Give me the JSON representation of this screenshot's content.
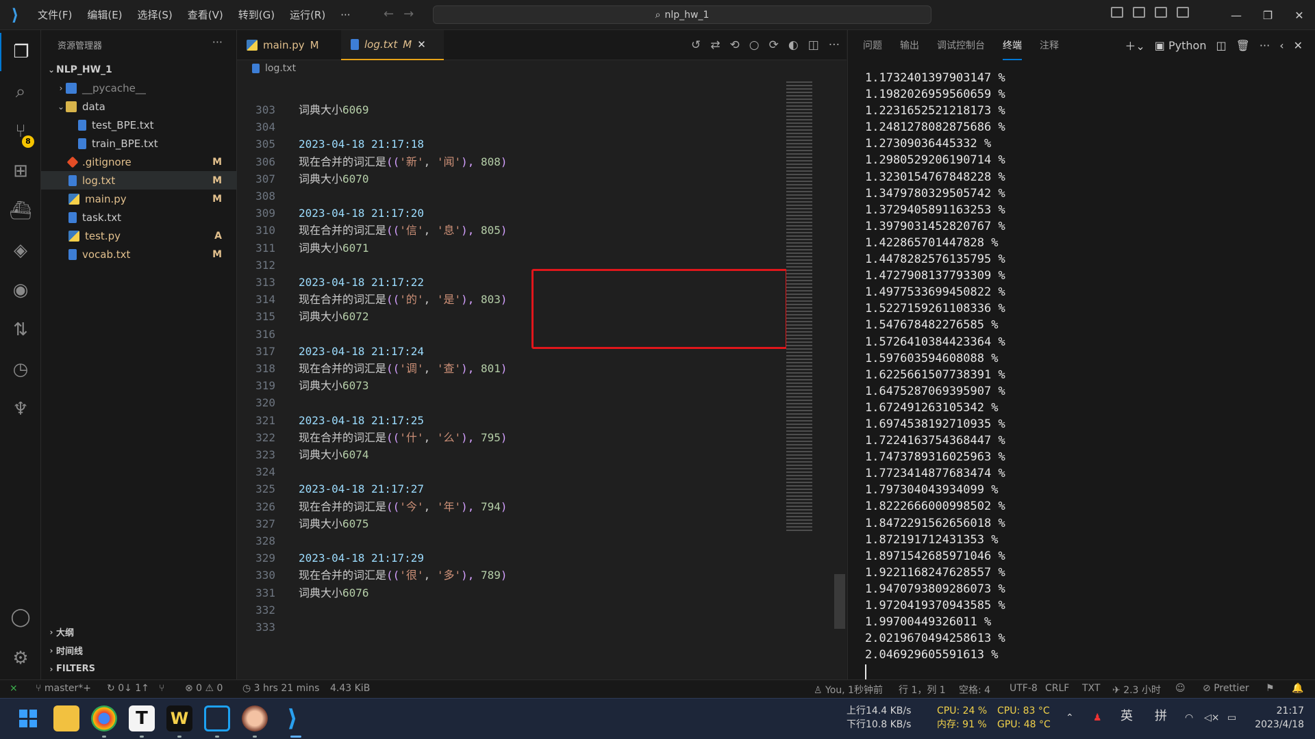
{
  "menu": [
    "文件(F)",
    "编辑(E)",
    "选择(S)",
    "查看(V)",
    "转到(G)",
    "运行(R)",
    "···"
  ],
  "search": {
    "text": "nlp_hw_1"
  },
  "sidebar": {
    "title": "资源管理器",
    "root": "NLP_HW_1",
    "items": [
      {
        "label": "__pycache__",
        "status": "",
        "color": "#8a8a8a"
      },
      {
        "label": "data",
        "status": "",
        "color": "#cccccc"
      },
      {
        "label": "test_BPE.txt",
        "status": "",
        "color": "#cccccc"
      },
      {
        "label": "train_BPE.txt",
        "status": "",
        "color": "#cccccc"
      },
      {
        "label": ".gitignore",
        "status": "M",
        "color": "#e2c08d"
      },
      {
        "label": "log.txt",
        "status": "M",
        "color": "#e2c08d"
      },
      {
        "label": "main.py",
        "status": "M",
        "color": "#e2c08d"
      },
      {
        "label": "task.txt",
        "status": "",
        "color": "#cccccc"
      },
      {
        "label": "test.py",
        "status": "A",
        "color": "#e2c08d"
      },
      {
        "label": "vocab.txt",
        "status": "M",
        "color": "#e2c08d"
      }
    ],
    "sections": [
      "大纲",
      "时间线",
      "FILTERS"
    ]
  },
  "source_control_badge": "8",
  "tabs": [
    {
      "label": "main.py",
      "status": "M"
    },
    {
      "label": "log.txt",
      "status": "M"
    }
  ],
  "breadcrumb": "log.txt",
  "code_lines": [
    {
      "n": "303",
      "parts": [
        [
          "词典大小",
          ""
        ],
        [
          "6069",
          "num"
        ]
      ]
    },
    {
      "n": "304",
      "parts": []
    },
    {
      "n": "305",
      "parts": [
        [
          "2023-04-18 21:17:18",
          "date"
        ]
      ]
    },
    {
      "n": "306",
      "parts": [
        [
          "现在合并的词汇是",
          ""
        ],
        [
          "((",
          "paren"
        ],
        [
          "'新'",
          "str"
        ],
        [
          ", ",
          ""
        ],
        [
          "'闻'",
          "str"
        ],
        [
          "), ",
          "paren"
        ],
        [
          "808",
          "num"
        ],
        [
          ")",
          "paren"
        ]
      ]
    },
    {
      "n": "307",
      "parts": [
        [
          "词典大小",
          ""
        ],
        [
          "6070",
          "num"
        ]
      ]
    },
    {
      "n": "308",
      "parts": []
    },
    {
      "n": "309",
      "parts": [
        [
          "2023-04-18 21:17:20",
          "date"
        ]
      ]
    },
    {
      "n": "310",
      "parts": [
        [
          "现在合并的词汇是",
          ""
        ],
        [
          "((",
          "paren"
        ],
        [
          "'信'",
          "str"
        ],
        [
          ", ",
          ""
        ],
        [
          "'息'",
          "str"
        ],
        [
          "), ",
          "paren"
        ],
        [
          "805",
          "num"
        ],
        [
          ")",
          "paren"
        ]
      ]
    },
    {
      "n": "311",
      "parts": [
        [
          "词典大小",
          ""
        ],
        [
          "6071",
          "num"
        ]
      ]
    },
    {
      "n": "312",
      "parts": []
    },
    {
      "n": "313",
      "parts": [
        [
          "2023-04-18 21:17:22",
          "date"
        ]
      ]
    },
    {
      "n": "314",
      "parts": [
        [
          "现在合并的词汇是",
          ""
        ],
        [
          "((",
          "paren"
        ],
        [
          "'的'",
          "str"
        ],
        [
          ", ",
          ""
        ],
        [
          "'是'",
          "str"
        ],
        [
          "), ",
          "paren"
        ],
        [
          "803",
          "num"
        ],
        [
          ")",
          "paren"
        ]
      ]
    },
    {
      "n": "315",
      "parts": [
        [
          "词典大小",
          ""
        ],
        [
          "6072",
          "num"
        ]
      ]
    },
    {
      "n": "316",
      "parts": []
    },
    {
      "n": "317",
      "parts": [
        [
          "2023-04-18 21:17:24",
          "date"
        ]
      ]
    },
    {
      "n": "318",
      "parts": [
        [
          "现在合并的词汇是",
          ""
        ],
        [
          "((",
          "paren"
        ],
        [
          "'调'",
          "str"
        ],
        [
          ", ",
          ""
        ],
        [
          "'查'",
          "str"
        ],
        [
          "), ",
          "paren"
        ],
        [
          "801",
          "num"
        ],
        [
          ")",
          "paren"
        ]
      ]
    },
    {
      "n": "319",
      "parts": [
        [
          "词典大小",
          ""
        ],
        [
          "6073",
          "num"
        ]
      ]
    },
    {
      "n": "320",
      "parts": []
    },
    {
      "n": "321",
      "parts": [
        [
          "2023-04-18 21:17:25",
          "date"
        ]
      ]
    },
    {
      "n": "322",
      "parts": [
        [
          "现在合并的词汇是",
          ""
        ],
        [
          "((",
          "paren"
        ],
        [
          "'什'",
          "str"
        ],
        [
          ", ",
          ""
        ],
        [
          "'么'",
          "str"
        ],
        [
          "), ",
          "paren"
        ],
        [
          "795",
          "num"
        ],
        [
          ")",
          "paren"
        ]
      ]
    },
    {
      "n": "323",
      "parts": [
        [
          "词典大小",
          ""
        ],
        [
          "6074",
          "num"
        ]
      ]
    },
    {
      "n": "324",
      "parts": []
    },
    {
      "n": "325",
      "parts": [
        [
          "2023-04-18 21:17:27",
          "date"
        ]
      ]
    },
    {
      "n": "326",
      "parts": [
        [
          "现在合并的词汇是",
          ""
        ],
        [
          "((",
          "paren"
        ],
        [
          "'今'",
          "str"
        ],
        [
          ", ",
          ""
        ],
        [
          "'年'",
          "str"
        ],
        [
          "), ",
          "paren"
        ],
        [
          "794",
          "num"
        ],
        [
          ")",
          "paren"
        ]
      ]
    },
    {
      "n": "327",
      "parts": [
        [
          "词典大小",
          ""
        ],
        [
          "6075",
          "num"
        ]
      ]
    },
    {
      "n": "328",
      "parts": []
    },
    {
      "n": "329",
      "parts": [
        [
          "2023-04-18 21:17:29",
          "date"
        ]
      ]
    },
    {
      "n": "330",
      "parts": [
        [
          "现在合并的词汇是",
          ""
        ],
        [
          "((",
          "paren"
        ],
        [
          "'很'",
          "str"
        ],
        [
          ", ",
          ""
        ],
        [
          "'多'",
          "str"
        ],
        [
          "), ",
          "paren"
        ],
        [
          "789",
          "num"
        ],
        [
          ")",
          "paren"
        ]
      ]
    },
    {
      "n": "331",
      "parts": [
        [
          "词典大小",
          ""
        ],
        [
          "6076",
          "num"
        ]
      ]
    },
    {
      "n": "332",
      "parts": []
    },
    {
      "n": "333",
      "parts": []
    }
  ],
  "panel": {
    "tabs": [
      "问题",
      "输出",
      "调试控制台",
      "终端",
      "注释"
    ],
    "active_tab": "终端",
    "shell": "Python",
    "terminal_lines": [
      "1.1732401397903147 %",
      "1.1982026959560659 %",
      "1.2231652521218173 %",
      "1.2481278082875686 %",
      "1.27309036445332 %",
      "1.2980529206190714 %",
      "1.3230154767848228 %",
      "1.3479780329505742 %",
      "1.3729405891163253 %",
      "1.3979031452820767 %",
      "1.422865701447828 %",
      "1.4478282576135795 %",
      "1.4727908137793309 %",
      "1.4977533699450822 %",
      "1.5227159261108336 %",
      "1.547678482276585 %",
      "1.5726410384423364 %",
      "1.597603594608088 %",
      "1.6225661507738391 %",
      "1.6475287069395907 %",
      "1.672491263105342 %",
      "1.6974538192710935 %",
      "1.7224163754368447 %",
      "1.7473789316025963 %",
      "1.7723414877683474 %",
      "1.797304043934099 %",
      "1.8222666000998502 %",
      "1.8472291562656018 %",
      "1.872191712431353 %",
      "1.8971542685971046 %",
      "1.9221168247628557 %",
      "1.9470793809286073 %",
      "1.9720419370943585 %",
      "1.99700449326011 %",
      "2.0219670494258613 %",
      "2.046929605591613 %"
    ]
  },
  "status": {
    "branch": "master*+",
    "sync": "0↓ 1↑",
    "problems": "⊗ 0 ⚠ 0",
    "time": "3 hrs 21 mins",
    "size": "4.43 KiB",
    "blame": "You, 1秒钟前",
    "position": "行 1，列 1",
    "spaces": "空格: 4",
    "encoding": "UTF-8",
    "eol": "CRLF",
    "lang": "TXT",
    "elapsed": "2.3 小时",
    "prettier": "Prettier"
  },
  "taskbar": {
    "net_up": "上行14.4 KB/s",
    "net_down": "下行10.8 KB/s",
    "cpu": "CPU: 24 %",
    "mem": "内存: 91 %",
    "cpu_temp": "CPU: 83 °C",
    "gpu_temp": "GPU: 48 °C",
    "ime1": "英",
    "ime2": "拼",
    "clock_time": "21:17",
    "clock_date": "2023/4/18"
  }
}
